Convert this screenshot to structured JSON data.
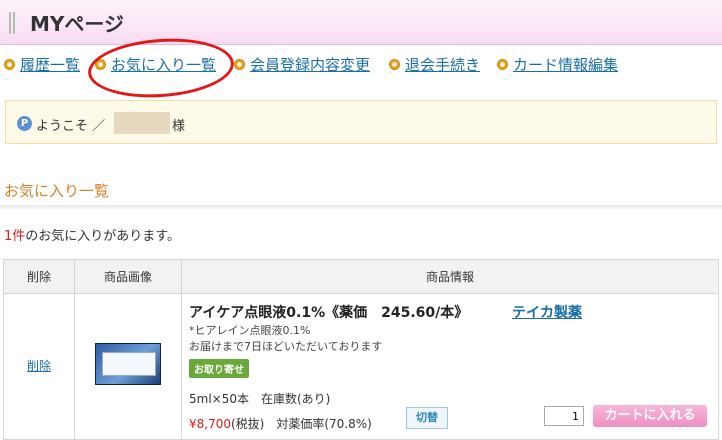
{
  "page": {
    "title": "MYページ"
  },
  "nav": {
    "items": [
      {
        "label": "履歴一覧"
      },
      {
        "label": "お気に入り一覧"
      },
      {
        "label": "会員登録内容変更"
      },
      {
        "label": "退会手続き"
      },
      {
        "label": "カード情報編集"
      }
    ]
  },
  "welcome": {
    "badge": "P",
    "text": "ようこそ ／",
    "suffix": "様"
  },
  "section": {
    "title": "お気に入り一覧",
    "count_num": "1件",
    "count_text": "のお気に入りがあります。"
  },
  "table": {
    "headers": [
      "削除",
      "商品画像",
      "商品情報"
    ],
    "rows": [
      {
        "delete_label": "削除",
        "product_name": "アイケア点眼液0.1%《薬価　245.60/本》",
        "maker": "テイカ製薬",
        "sub1": "*ヒアレイン点眼液0.1%",
        "sub2": "お届けまで7日ほどいただいております",
        "badge": "お取り寄せ",
        "spec": "5ml×50本　在庫数(あり)",
        "price": "¥8,700",
        "price_suffix": "(税抜)　対薬価率(70.8%)",
        "switch_label": "切替",
        "qty": "1",
        "cart_label": "カートに入れる"
      }
    ]
  },
  "colors": {
    "accent_pink": "#ee8fc3",
    "link": "#1a6ea8",
    "annotation": "#e01818"
  }
}
